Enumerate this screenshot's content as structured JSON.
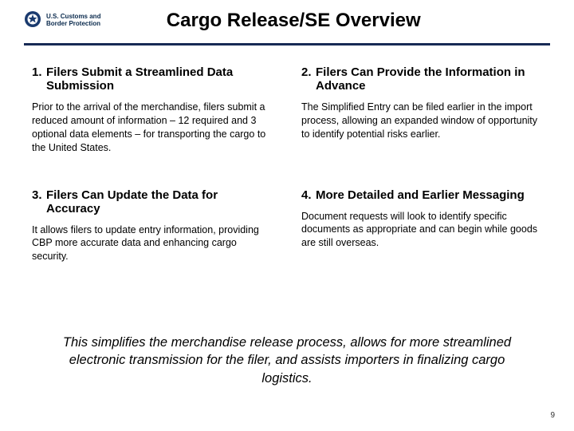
{
  "header": {
    "agency_line1": "U.S. Customs and",
    "agency_line2": "Border Protection",
    "title": "Cargo Release/SE Overview"
  },
  "items": [
    {
      "num": "1.",
      "heading": "Filers Submit a Streamlined Data Submission",
      "body": "Prior to the arrival of the merchandise, filers submit a reduced amount of information – 12 required and 3 optional data elements – for transporting the cargo to the United States."
    },
    {
      "num": "2.",
      "heading": "Filers Can Provide the Information in Advance",
      "body": "The Simplified Entry can be filed earlier in the import process, allowing an expanded window of opportunity to identify potential risks earlier."
    },
    {
      "num": "3.",
      "heading": "Filers Can Update the Data for Accuracy",
      "body": "It allows filers to update entry information, providing CBP more accurate data and enhancing cargo security."
    },
    {
      "num": "4.",
      "heading": "More Detailed and Earlier Messaging",
      "body": "Document requests will look to identify specific documents as appropriate and can begin while goods are still overseas."
    }
  ],
  "summary": "This simplifies the merchandise release process, allows for more streamlined electronic transmission for the filer, and assists importers in finalizing cargo logistics.",
  "page_number": "9"
}
